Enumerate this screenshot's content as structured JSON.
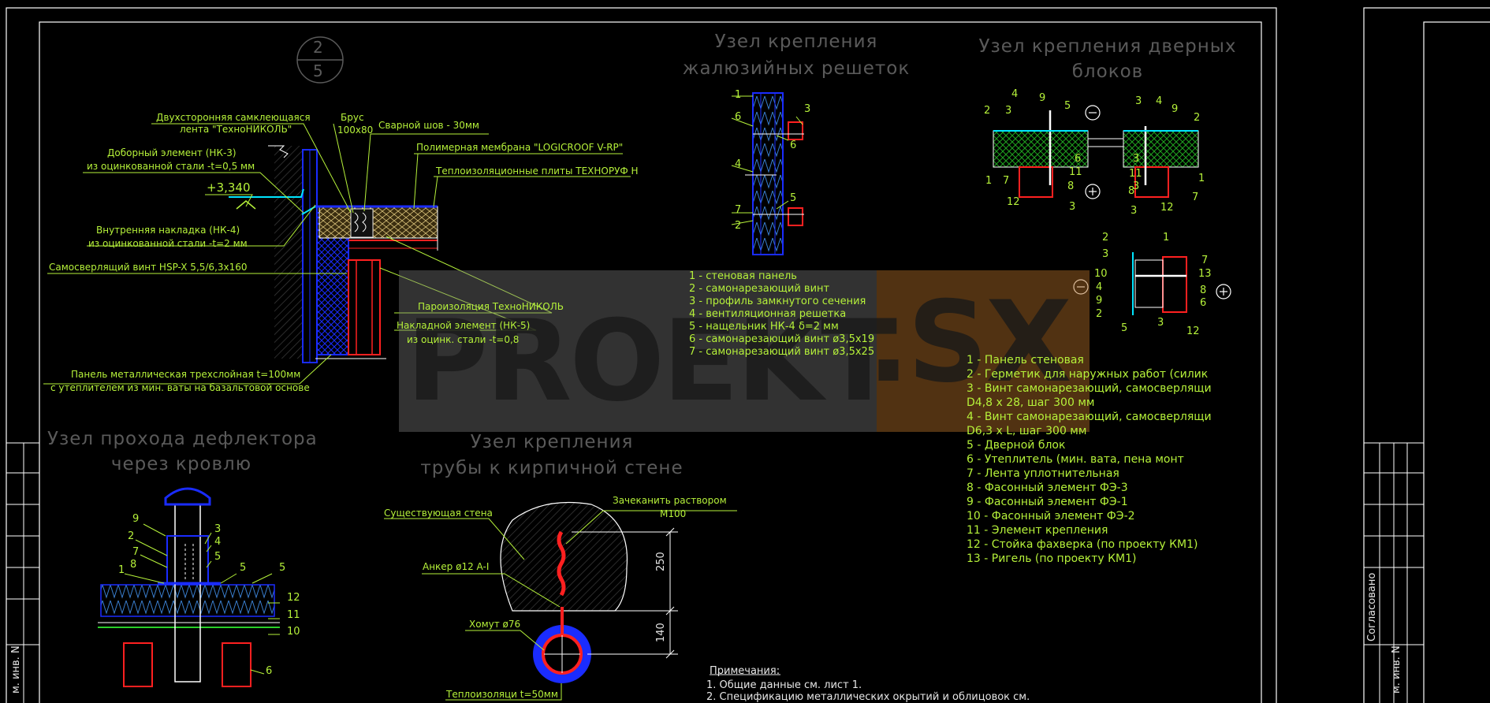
{
  "sheet": {
    "circle_top": "2",
    "circle_bottom": "5"
  },
  "titles": {
    "louver": [
      "Узел крепления",
      "жалюзийных решеток"
    ],
    "door": [
      "Узел крепления дверных",
      "блоков"
    ],
    "deflector": [
      "Узел прохода дефлектора",
      "через кровлю"
    ],
    "pipe": [
      "Узел крепления",
      "трубы к кирпичной стене"
    ]
  },
  "roof_node": {
    "labels": [
      "Двухсторонняя самклеющаяся",
      "лента \"ТехноНИКОЛЬ\"",
      "Брус",
      "100х80",
      "Сварной шов - 30мм",
      "Доборный элемент (НК-3)",
      "из оцинкованной стали -t=0,5 мм",
      "Полимерная мембрана \"LOGICROOF V-RP\"",
      "Теплоизоляционные плиты ТЕХНОРУФ Н",
      "+3,340",
      "Внутренняя накладка (НК-4)",
      "из оцинкованной стали -t=2 мм",
      "Самосверлящий винт HSP-X 5,5/6,3х160",
      "Пароизоляция ТехноНИКОЛЬ",
      "Накладной элемент (НК-5)",
      "из оцинк. стали -t=0,8",
      "Панель металлическая трехслойная t=100мм",
      "с утеплителем из мин. ваты на базальтовой основе"
    ]
  },
  "louver_node": {
    "callouts": [
      "1",
      "3",
      "6",
      "6",
      "4",
      "5",
      "7",
      "2"
    ],
    "legend": [
      "1 - стеновая панель",
      "2 - самонарезающий винт",
      "3 - профиль замкнутого сечения",
      "4 - вентиляционная решетка",
      "5 - нащельник НК-4 δ=2 мм",
      "6 - самонарезающий винт ø3,5х19",
      "7 - самонарезающий винт ø3,5х25"
    ]
  },
  "door_node": {
    "callouts_top": [
      "2",
      "3",
      "4",
      "9",
      "5",
      "3",
      "4",
      "9",
      "2",
      "6",
      "11",
      "3",
      "1",
      "7",
      "8",
      "11",
      "3",
      "8",
      "1",
      "12",
      "3",
      "3",
      "12",
      "7"
    ],
    "callouts_bottom": [
      "2",
      "1",
      "3",
      "7",
      "10",
      "13",
      "4",
      "8",
      "9",
      "6",
      "2",
      "5",
      "3",
      "12"
    ],
    "signs": [
      "⊖",
      "⊕",
      "⊖",
      "⊕"
    ],
    "legend": [
      "1 - Панель стеновая",
      "2 - Герметик для наружных работ (силик",
      "3 - Винт самонарезающий, самосверлящи",
      "D4,8 x 28, шаг 300 мм",
      "4 - Винт самонарезающий, самосверлящи",
      "D6,3 x L, шаг 300 мм",
      "5 - Дверной блок",
      "6 - Утеплитель (мин. вата, пена монт",
      "7 - Лента уплотнительная",
      "8 - Фасонный элемент ФЭ-3",
      "9 - Фасонный элемент ФЭ-1",
      "10 - Фасонный элемент ФЭ-2",
      "11 - Элемент крепления",
      "12 - Стойка фахверка (по проекту КМ1)",
      "13 - Ригель (по проекту КМ1)"
    ]
  },
  "deflector_node": {
    "callouts": [
      "9",
      "3",
      "2",
      "4",
      "7",
      "5",
      "1",
      "8",
      "5",
      "5",
      "12",
      "11",
      "10",
      "6"
    ]
  },
  "pipe_node": {
    "labels": [
      "Существующая стена",
      "Зачеканить раствором",
      "М100",
      "Анкер ø12 A-I",
      "Хомут ø76",
      "Теплоизоляци t=50мм"
    ],
    "dims": [
      "250",
      "140"
    ]
  },
  "notes": {
    "heading": "Примечания:",
    "items": [
      "1. Общие данные см. лист 1.",
      "2. Спецификацию металлических окрытий и облицовок см."
    ]
  },
  "stamp": {
    "left_text": "м. инв. N",
    "right_text": "м. инв. N",
    "agreed": "Согласовано"
  },
  "watermark": {
    "word1": "PROEKT",
    "word2": ".SX"
  },
  "colors": {
    "background": "#000000",
    "frame": "#ffffff",
    "annotation": "#b6f23a",
    "title": "#5a5a5a",
    "panel_blue": "#1a2cff",
    "accent_red": "#ff2020",
    "cyan": "#00e5ff",
    "insulation": "#d9c27a"
  }
}
